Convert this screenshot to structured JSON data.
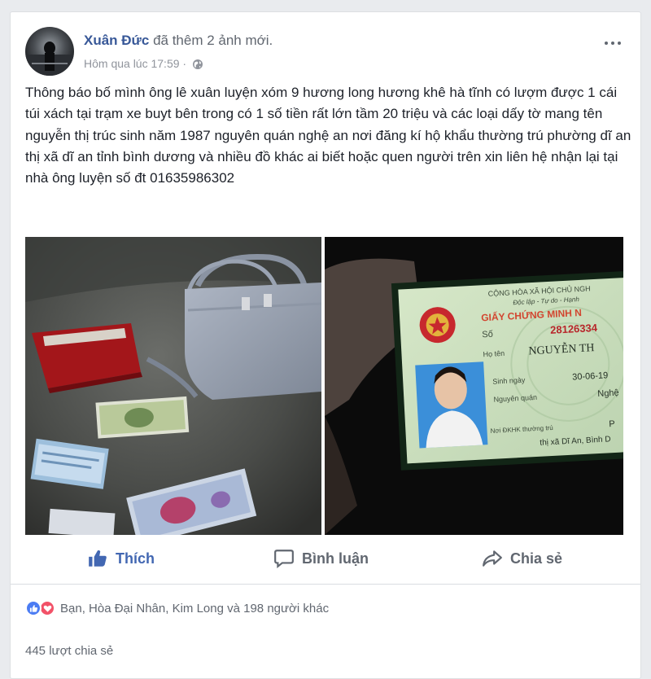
{
  "post": {
    "author": "Xuân Đức",
    "action": "đã thêm 2 ảnh mới.",
    "timestamp": "Hôm qua lúc 17:59",
    "separator": "·",
    "privacy_icon": "globe-icon",
    "more_icon": "more-options-icon",
    "text": "Thông báo bố mình ông lê xuân luyện xóm 9 hương long hương khê hà tĩnh có lượm được 1 cái túi xách tại trạm xe buyt bên trong có 1 số tiền rất lớn tầm 20 triệu và các loại dấy tờ mang tên nguyễn thị trúc sinh năm 1987 nguyên quán nghệ an nơi đăng kí hộ khẩu thường trú phường dĩ an thị xã dĩ an tỉnh bình dương và nhiều đồ khác ai biết hoặc quen người trên xin liên hệ nhận lại tại nhà ông luyện số đt 01635986302"
  },
  "photos": {
    "photo1_desc": "bag-money-photo",
    "photo2_desc": "id-card-photo",
    "id_card": {
      "header": "CỘNG HÒA XÃ HỘI CHỦ NGH",
      "subheader": "Độc lập - Tự do - Hạnh",
      "title": "GIẤY CHỨNG MINH N",
      "number_label": "Số",
      "number": "28126334",
      "name_label": "Họ tên",
      "name": "NGUYỄN TH",
      "dob_label": "Sinh ngày",
      "dob": "30-06-19",
      "origin_label": "Nguyên quán",
      "origin": "Nghệ",
      "residence_label": "Nơi ĐKHK thường trú",
      "residence_1": "P",
      "residence_2": "thị xã Dĩ An, Bình D"
    }
  },
  "actions": {
    "like": "Thích",
    "comment": "Bình luận",
    "share": "Chia sẻ"
  },
  "reactions": {
    "summary": "Bạn, Hòa Đại Nhân, Kim Long và 198 người khác"
  },
  "shares": {
    "text": "445 lượt chia sẻ"
  },
  "colors": {
    "link": "#385898",
    "like_active": "#4267b2",
    "muted": "#616770",
    "background": "#e9ebee"
  }
}
